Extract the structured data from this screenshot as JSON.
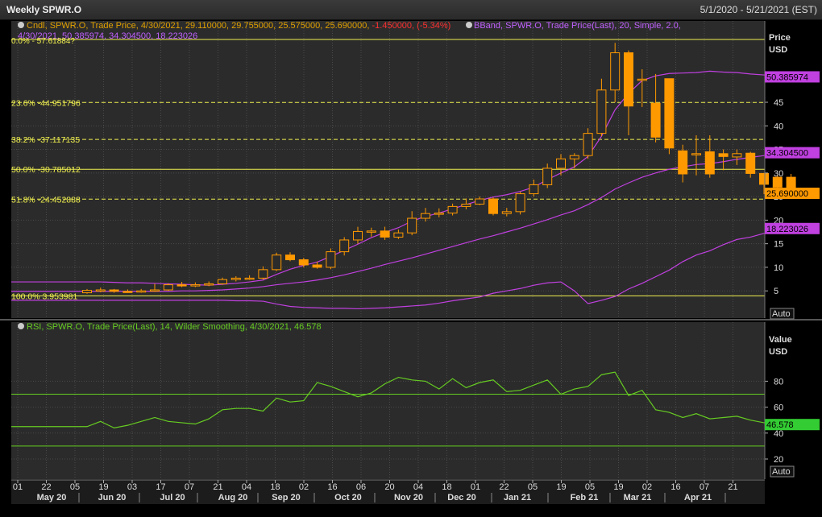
{
  "window": {
    "title": "Weekly SPWR.O",
    "date_range": "5/1/2020 - 5/21/2021 (EST)"
  },
  "price_panel": {
    "legend_candle_prefix": "Cndl, SPWR.O, Trade Price, 4/30/2021, 29.110000, 29.755000, 25.575000, 25.690000, ",
    "legend_candle_change": "-1.450000, (-5.34%)",
    "legend_bband_line1": "BBand, SPWR.O, Trade Price(Last), 20, Simple, 2.0,",
    "legend_bband_line2": "4/30/2021, 50.385974, 34.304500, 18.223026",
    "axis_title": "Price",
    "axis_unit": "USD",
    "auto_label": "Auto",
    "fib_partial_label": "0.0% - 57.61884?",
    "fib": [
      {
        "label": "23.6% -44.951796",
        "value": 44.951796,
        "color": "#f0f050",
        "dashed": true
      },
      {
        "label": "38.2% -37.117135",
        "value": 37.117135,
        "color": "#f0f050",
        "dashed": true
      },
      {
        "label": "50.0% -30.785012",
        "value": 30.785012,
        "color": "#f0f050",
        "dashed": false
      },
      {
        "label": "51.8% -24.452888",
        "value": 24.452888,
        "color": "#f0f050",
        "dashed": true
      },
      {
        "label": "100.0% 3.953981",
        "value": 3.953981,
        "color": "#f0f050",
        "dashed": false
      }
    ],
    "top_line_value": 57.61884,
    "badges": [
      {
        "text": "50.385974",
        "value": 50.385974,
        "bg": "#c040e0",
        "fg": "#000000"
      },
      {
        "text": "34.304500",
        "value": 34.3045,
        "bg": "#c040e0",
        "fg": "#000000"
      },
      {
        "text": "25.690000",
        "value": 25.69,
        "bg": "#ff9900",
        "fg": "#000000"
      },
      {
        "text": "18.223026",
        "value": 18.223026,
        "bg": "#c040e0",
        "fg": "#000000"
      }
    ]
  },
  "rsi_panel": {
    "legend": "RSI, SPWR.O, Trade Price(Last), 14, Wilder Smoothing, 4/30/2021, 46.578",
    "axis_title": "Value",
    "axis_unit": "USD",
    "auto_label": "Auto",
    "badge": {
      "text": "46.578",
      "value": 46.578,
      "bg": "#33cc33",
      "fg": "#000000"
    },
    "upper_band": 70,
    "lower_band": 30
  },
  "x_axis": {
    "day_ticks": [
      "01",
      "22",
      "05",
      "19",
      "03",
      "17",
      "07",
      "21",
      "04",
      "18",
      "02",
      "16",
      "06",
      "20",
      "04",
      "18",
      "01",
      "22",
      "05",
      "19",
      "05",
      "19",
      "02",
      "16",
      "07",
      "21"
    ],
    "month_labels": [
      "May 20",
      "Jun 20",
      "Jul 20",
      "Aug 20",
      "Sep 20",
      "Oct 20",
      "Nov 20",
      "Dec 20",
      "Jan 21",
      "Feb 21",
      "Mar 21",
      "Apr 21"
    ]
  },
  "colors": {
    "background": "#000000",
    "plot_bg": "#2b2b2b",
    "grid": "#4a4a4a",
    "candle": "#ff9900",
    "bband": "#c040e0",
    "rsi": "#66cc22",
    "legend_text": "#e0a000",
    "legend_change": "#ff3030",
    "legend_bband": "#c060ff"
  },
  "chart_data": [
    {
      "type": "candlestick",
      "title": "Weekly SPWR.O",
      "ylabel": "Price USD",
      "ylim": [
        0,
        60
      ],
      "y_ticks": [
        5,
        10,
        15,
        20,
        25,
        30,
        35,
        40,
        45
      ],
      "scale": "linear",
      "grid": true,
      "weeks": [
        "2020-05-01",
        "2020-05-08",
        "2020-05-15",
        "2020-05-22",
        "2020-05-29",
        "2020-06-05",
        "2020-06-12",
        "2020-06-19",
        "2020-06-26",
        "2020-07-03",
        "2020-07-10",
        "2020-07-17",
        "2020-07-24",
        "2020-07-31",
        "2020-08-07",
        "2020-08-14",
        "2020-08-21",
        "2020-08-28",
        "2020-09-04",
        "2020-09-11",
        "2020-09-18",
        "2020-09-25",
        "2020-10-02",
        "2020-10-09",
        "2020-10-16",
        "2020-10-23",
        "2020-10-30",
        "2020-11-06",
        "2020-11-13",
        "2020-11-20",
        "2020-11-27",
        "2020-12-04",
        "2020-12-11",
        "2020-12-18",
        "2020-12-25",
        "2021-01-01",
        "2021-01-08",
        "2021-01-15",
        "2021-01-22",
        "2021-01-29",
        "2021-02-05",
        "2021-02-12",
        "2021-02-19",
        "2021-02-26",
        "2021-03-05",
        "2021-03-12",
        "2021-03-19",
        "2021-03-26",
        "2021-04-02",
        "2021-04-09",
        "2021-04-16",
        "2021-04-23",
        "2021-04-30"
      ],
      "open": [
        4.6,
        5.1,
        5.2,
        4.9,
        4.8,
        5.0,
        5.2,
        6.3,
        6.2,
        6.3,
        6.5,
        7.4,
        7.7,
        7.7,
        9.5,
        12.6,
        11.6,
        10.5,
        10.0,
        13.3,
        15.8,
        17.6,
        17.7,
        16.4,
        17.3,
        20.4,
        21.4,
        21.5,
        22.9,
        23.4,
        24.5,
        21.4,
        21.8,
        25.6,
        27.5,
        31.0,
        33.0,
        33.7,
        38.4,
        47.6,
        55.5,
        49.9,
        44.8,
        50.0,
        34.7,
        34.1,
        34.5,
        34.1,
        33.4,
        34.2,
        29.9,
        29.1,
        29.1
      ],
      "close": [
        5.1,
        5.2,
        4.9,
        4.8,
        5.0,
        5.2,
        6.3,
        6.2,
        6.3,
        6.5,
        7.4,
        7.7,
        7.7,
        9.5,
        12.6,
        11.6,
        10.5,
        10.0,
        13.3,
        15.8,
        17.6,
        17.7,
        16.4,
        17.3,
        20.4,
        21.4,
        21.5,
        22.9,
        23.4,
        24.5,
        21.4,
        21.8,
        25.6,
        27.5,
        31.0,
        33.0,
        33.7,
        38.4,
        47.6,
        55.5,
        44.2,
        49.9,
        37.6,
        35.3,
        29.8,
        34.1,
        29.8,
        33.5,
        34.1,
        29.9,
        27.6,
        27.0,
        25.7
      ],
      "high": [
        5.4,
        5.7,
        5.4,
        5.3,
        5.4,
        6.5,
        6.6,
        6.9,
        6.8,
        7.0,
        7.8,
        8.1,
        8.3,
        10.2,
        13.1,
        13.2,
        12.0,
        11.2,
        14.0,
        16.4,
        18.6,
        18.4,
        18.6,
        18.0,
        21.9,
        22.6,
        22.5,
        23.5,
        24.6,
        25.0,
        24.8,
        22.6,
        26.0,
        28.6,
        32.0,
        34.0,
        34.2,
        39.5,
        50.0,
        57.6,
        56.0,
        52.0,
        51.0,
        38.0,
        36.0,
        38.0,
        38.0,
        35.0,
        35.0,
        34.5,
        30.0,
        29.6,
        29.8
      ],
      "low": [
        4.4,
        4.7,
        4.6,
        4.6,
        4.6,
        4.8,
        5.0,
        5.8,
        5.8,
        6.0,
        6.3,
        7.0,
        7.3,
        7.4,
        9.2,
        11.3,
        10.0,
        9.7,
        9.6,
        12.5,
        15.0,
        16.5,
        15.8,
        16.0,
        16.8,
        19.7,
        20.6,
        21.0,
        22.3,
        23.2,
        21.0,
        20.8,
        21.2,
        25.0,
        26.8,
        29.5,
        31.0,
        33.0,
        37.8,
        45.0,
        38.0,
        44.0,
        36.5,
        34.0,
        28.0,
        29.5,
        29.0,
        30.6,
        31.7,
        29.0,
        25.5,
        25.0,
        25.6
      ]
    },
    {
      "type": "line",
      "title": "BBand, SPWR.O, Trade Price(Last), 20, Simple, 2.0",
      "series": [
        {
          "name": "BBand Upper",
          "values": [
            6.9,
            6.9,
            6.8,
            6.7,
            6.7,
            6.6,
            6.5,
            6.4,
            6.3,
            6.2,
            6.4,
            6.6,
            6.9,
            7.3,
            8.5,
            9.6,
            10.4,
            11.1,
            12.3,
            13.6,
            14.9,
            16.3,
            17.4,
            18.4,
            19.8,
            20.8,
            21.5,
            22.4,
            23.3,
            24.2,
            24.9,
            25.4,
            26.1,
            27.0,
            28.6,
            30.0,
            31.3,
            33.5,
            37.8,
            43.4,
            46.9,
            49.6,
            50.6,
            51.1,
            51.2,
            51.3,
            51.6,
            51.4,
            51.3,
            51.0,
            50.8,
            50.6,
            50.4
          ]
        },
        {
          "name": "BBand Middle",
          "values": [
            4.9,
            4.9,
            4.9,
            4.9,
            4.9,
            4.9,
            4.9,
            5.0,
            5.0,
            5.1,
            5.2,
            5.4,
            5.6,
            5.9,
            6.3,
            6.6,
            6.9,
            7.3,
            7.8,
            8.4,
            9.1,
            9.8,
            10.6,
            11.3,
            12.0,
            12.8,
            13.6,
            14.4,
            15.2,
            16.0,
            16.7,
            17.5,
            18.3,
            19.2,
            20.1,
            21.1,
            22.0,
            23.3,
            24.8,
            26.6,
            27.9,
            29.1,
            30.0,
            30.8,
            31.3,
            31.8,
            32.0,
            32.4,
            32.9,
            33.3,
            33.7,
            34.0,
            34.3
          ]
        },
        {
          "name": "BBand Lower",
          "values": [
            3.0,
            3.0,
            3.0,
            3.0,
            3.0,
            3.0,
            3.0,
            3.0,
            3.0,
            3.0,
            3.0,
            2.9,
            2.9,
            2.8,
            2.2,
            1.7,
            1.5,
            1.4,
            1.3,
            1.3,
            1.2,
            1.3,
            1.4,
            1.6,
            1.8,
            2.0,
            2.4,
            2.9,
            3.3,
            3.7,
            4.5,
            5.0,
            5.5,
            6.2,
            6.7,
            6.9,
            5.0,
            2.3,
            3.0,
            3.8,
            5.4,
            6.6,
            8.0,
            9.4,
            11.2,
            12.6,
            13.5,
            14.8,
            15.9,
            16.4,
            17.2,
            17.9,
            18.2
          ]
        }
      ]
    },
    {
      "type": "line",
      "title": "RSI, SPWR.O, Trade Price(Last), 14, Wilder Smoothing",
      "ylabel": "Value USD",
      "ylim": [
        10,
        100
      ],
      "y_ticks": [
        20,
        40,
        60,
        80
      ],
      "grid": true,
      "series": [
        {
          "name": "RSI",
          "values": [
            45,
            49,
            44,
            46,
            49,
            52,
            49,
            48,
            47,
            51,
            58,
            59,
            59,
            57,
            67,
            64,
            65,
            79,
            76,
            72,
            68,
            71,
            78,
            83,
            81,
            80,
            74,
            82,
            75,
            79,
            81,
            72,
            73,
            77,
            81,
            70,
            74,
            76,
            85,
            87,
            69,
            73,
            58,
            56,
            52,
            55,
            51,
            52,
            53,
            50,
            48,
            49,
            46.6
          ]
        }
      ]
    }
  ]
}
